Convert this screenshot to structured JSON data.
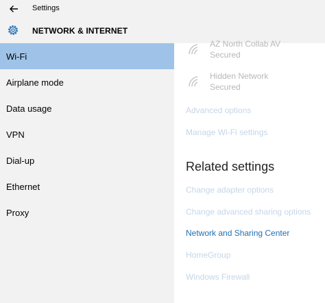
{
  "window": {
    "title": "Settings"
  },
  "header": {
    "title": "NETWORK & INTERNET"
  },
  "sidebar": {
    "items": [
      {
        "label": "Wi-Fi"
      },
      {
        "label": "Airplane mode"
      },
      {
        "label": "Data usage"
      },
      {
        "label": "VPN"
      },
      {
        "label": "Dial-up"
      },
      {
        "label": "Ethernet"
      },
      {
        "label": "Proxy"
      }
    ]
  },
  "main": {
    "networks": [
      {
        "name": "AZ North Collab AV",
        "status": "Secured"
      },
      {
        "name": "Hidden Network",
        "status": "Secured"
      }
    ],
    "advanced_options": "Advanced options",
    "manage_wifi": "Manage Wi-Fi settings",
    "related_heading": "Related settings",
    "related_links": [
      {
        "label": "Change adapter options"
      },
      {
        "label": "Change advanced sharing options"
      },
      {
        "label": "Network and Sharing Center"
      },
      {
        "label": "HomeGroup"
      },
      {
        "label": "Windows Firewall"
      }
    ]
  },
  "colors": {
    "selected_bg": "#9fc3e8",
    "sidebar_bg": "#f2f2f2",
    "link_active": "#1f6fb5",
    "link_faded": "#c5d6e8"
  },
  "icons": {
    "back": "back-arrow-icon",
    "settings": "gear-icon",
    "wifi": "wifi-secured-icon"
  }
}
